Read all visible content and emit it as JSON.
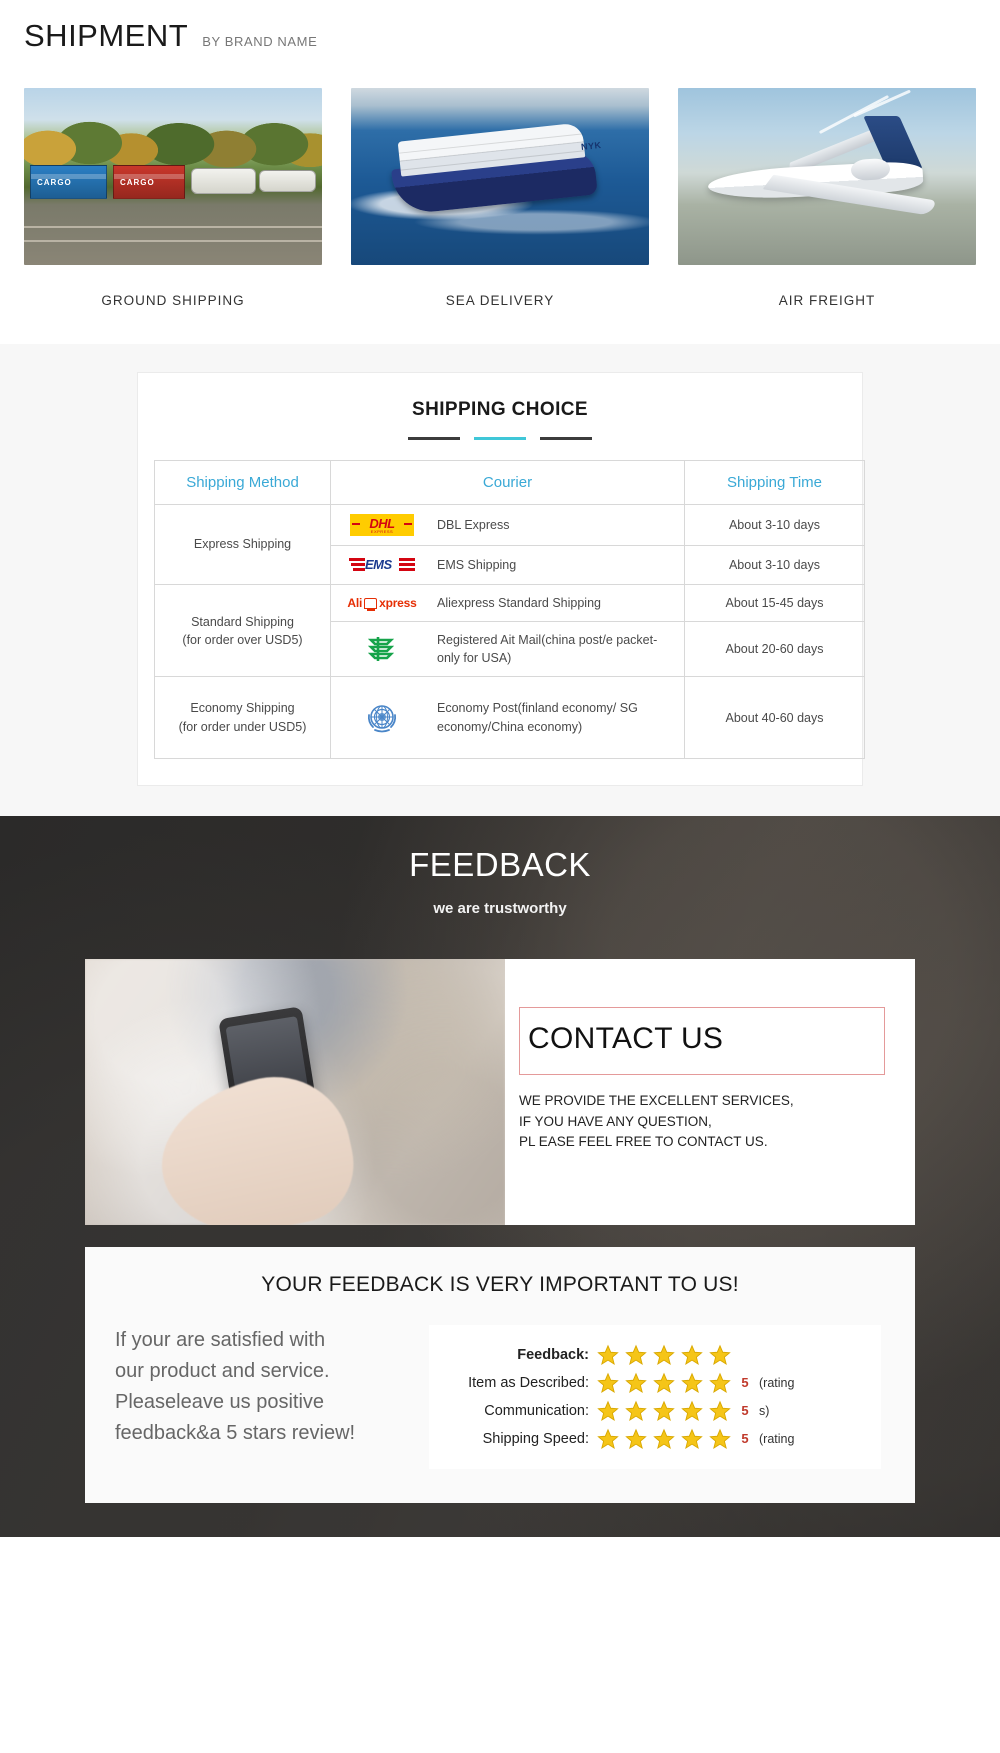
{
  "header": {
    "title": "SHIPMENT",
    "subtitle": "BY BRAND NAME"
  },
  "modes": [
    {
      "label": "GROUND SHIPPING",
      "icon": "train-icon",
      "cargo_text_1": "CARGO",
      "cargo_text_2": "CARGO"
    },
    {
      "label": "SEA DELIVERY",
      "icon": "cargo-ship-icon",
      "ship_name": "NYK"
    },
    {
      "label": "AIR FREIGHT",
      "icon": "airplane-icon"
    }
  ],
  "shipping_choice": {
    "title": "SHIPPING CHOICE",
    "headers": {
      "method": "Shipping Method",
      "courier": "Courier",
      "time": "Shipping Time"
    },
    "groups": [
      {
        "method": "Express Shipping",
        "rows": [
          {
            "logo": "dhl-logo",
            "courier": "DBL Express",
            "time": "About 3-10 days"
          },
          {
            "logo": "ems-logo",
            "courier": "EMS Shipping",
            "time": "About 3-10 days"
          }
        ]
      },
      {
        "method": "Standard Shipping\n(for order over USD5)",
        "method_line1": "Standard Shipping",
        "method_line2": "(for order over USD5)",
        "rows": [
          {
            "logo": "aliexpress-logo",
            "courier": "Aliexpress Standard Shipping",
            "time": "About 15-45 days"
          },
          {
            "logo": "china-post-logo",
            "courier": "Registered Ait Mail(china post/e packet-only for USA)",
            "time": "About 20-60 days"
          }
        ]
      },
      {
        "method": "Economy Shipping\n(for order under USD5)",
        "method_line1": "Economy Shipping",
        "method_line2": "(for order under USD5)",
        "rows": [
          {
            "logo": "un-logo",
            "courier": "Economy Post(finland economy/ SG economy/China economy)",
            "time": "About 40-60 days"
          }
        ]
      }
    ],
    "logo_labels": {
      "dhl_main": "DHL",
      "dhl_sub": "EXPRESS",
      "ems_main": "EMS",
      "ali_pre": "Ali",
      "ali_post": "xpress"
    }
  },
  "feedback": {
    "title": "FEEDBACK",
    "subtitle": "we are trustworthy",
    "contact": {
      "box_title": "CONTACT US",
      "line1": "WE PROVIDE THE EXCELLENT SERVICES,",
      "line2": "IF YOU HAVE ANY QUESTION,",
      "line3": "PL EASE FEEL FREE TO CONTACT US."
    },
    "rating": {
      "title": "YOUR FEEDBACK IS VERY IMPORTANT TO US!",
      "left_line1": "If your are satisfied with",
      "left_line2": "our product and service.",
      "left_line3": "Pleaseleave us positive",
      "left_line4": "feedback&a 5 stars review!",
      "rows": [
        {
          "label": "Feedback:",
          "bold": true,
          "stars": 5,
          "score": "",
          "suffix": ""
        },
        {
          "label": "Item as Described:",
          "bold": false,
          "stars": 5,
          "score": "5",
          "suffix": "(rating"
        },
        {
          "label": "Communication:",
          "bold": false,
          "stars": 5,
          "score": "5",
          "suffix": "s)"
        },
        {
          "label": "Shipping Speed:",
          "bold": false,
          "stars": 5,
          "score": "5",
          "suffix": "(rating"
        }
      ]
    }
  },
  "colors": {
    "accent_cyan": "#3fc7d8",
    "table_header": "#3aa9d6",
    "star": "#f5c518",
    "score_red": "#c0392b",
    "dhl_yellow": "#FFCC00",
    "dhl_red": "#D40511",
    "ems_blue": "#1b3a8f",
    "ali_red": "#E62E04",
    "china_post_green": "#16a34a",
    "un_blue": "#4a86c8"
  }
}
